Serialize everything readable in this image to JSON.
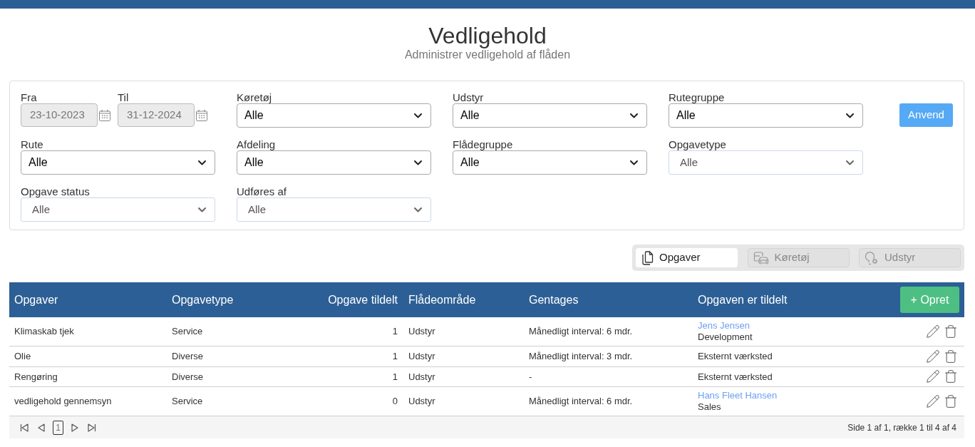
{
  "header": {
    "title": "Vedligehold",
    "subtitle": "Administrer vedligehold af flåden"
  },
  "filters": {
    "date_fields": [
      {
        "label": "Fra",
        "value": "23-10-2023",
        "disabled": true
      },
      {
        "label": "Til",
        "value": "31-12-2024",
        "disabled": true
      }
    ],
    "selects": [
      {
        "label": "Køretøj",
        "value": "Alle",
        "kind": "select"
      },
      {
        "label": "Udstyr",
        "value": "Alle",
        "kind": "select"
      },
      {
        "label": "Rutegruppe",
        "value": "Alle",
        "kind": "select"
      },
      {
        "label": "Rute",
        "value": "Alle",
        "kind": "select"
      },
      {
        "label": "Afdeling",
        "value": "Alle",
        "kind": "select"
      },
      {
        "label": "Flådegruppe",
        "value": "Alle",
        "kind": "select"
      },
      {
        "label": "Opgavetype",
        "value": "Alle",
        "kind": "multiselect"
      },
      {
        "label": "Opgave status",
        "value": "Alle",
        "kind": "multiselect"
      },
      {
        "label": "Udføres af",
        "value": "Alle",
        "kind": "multiselect"
      }
    ],
    "apply_button": "Anvend"
  },
  "view_tabs": [
    {
      "label": "Opgaver",
      "selected": true
    },
    {
      "label": "Køretøj",
      "selected": false
    },
    {
      "label": "Udstyr",
      "selected": false
    }
  ],
  "table": {
    "columns": [
      "Opgaver",
      "Opgavetype",
      "Opgave tildelt",
      "Flådeområde",
      "Gentages",
      "Opgaven er tildelt"
    ],
    "create_button": "+ Opret",
    "rows": [
      {
        "cells": [
          "Klimaskab tjek",
          "Service",
          "1",
          "Udstyr",
          "Månedligt interval: 6 mdr."
        ],
        "assigned_to": {
          "kind": "person",
          "name": "Jens Jensen",
          "department": "Development"
        }
      },
      {
        "cells": [
          "Olie",
          "Diverse",
          "1",
          "Udstyr",
          "Månedligt interval: 3 mdr."
        ],
        "assigned_to": {
          "kind": "text",
          "text": "Eksternt værksted"
        }
      },
      {
        "cells": [
          "Rengøring",
          "Diverse",
          "1",
          "Udstyr",
          "-"
        ],
        "assigned_to": {
          "kind": "text",
          "text": "Eksternt værksted"
        }
      },
      {
        "cells": [
          "vedligehold gennemsyn",
          "Service",
          "0",
          "Udstyr",
          "Månedligt interval: 6 mdr."
        ],
        "assigned_to": {
          "kind": "person",
          "name": "Hans Fleet Hansen",
          "department": "Sales"
        }
      }
    ]
  },
  "pager": {
    "pages": [
      {
        "label": "1",
        "selected": true
      }
    ],
    "summary": "Side 1 af 1, række 1 til 4 af 4"
  }
}
